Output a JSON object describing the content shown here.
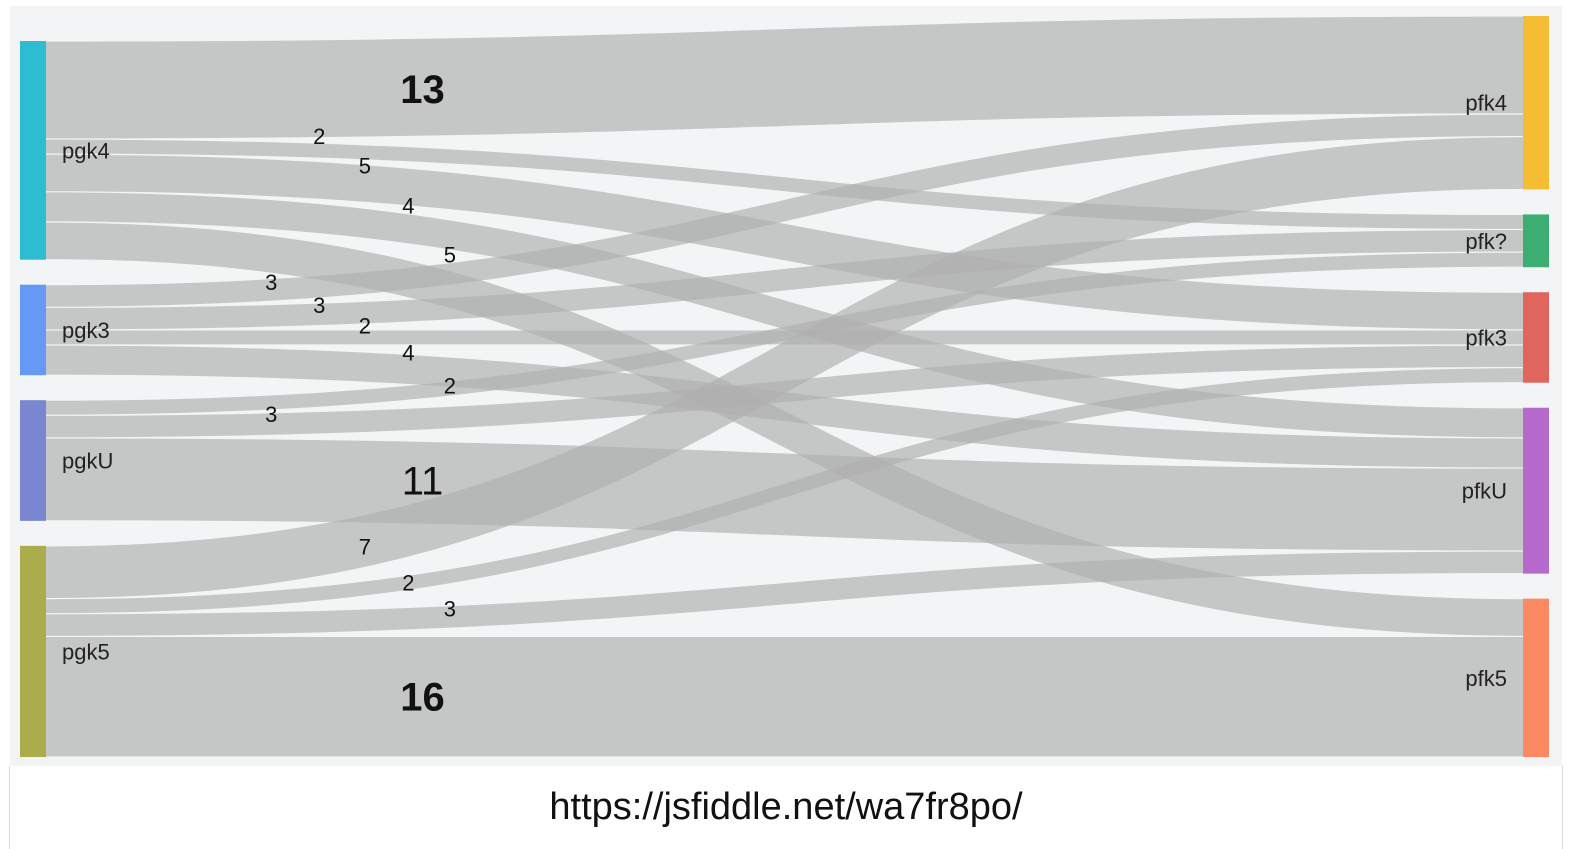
{
  "footer": {
    "url": "https://jsfiddle.net/wa7fr8po/"
  },
  "colors": {
    "background": "#f3f4f5",
    "link": "#b0b0b0",
    "pgk4": "#2ebcd3",
    "pgk3": "#6699f5",
    "pgkU": "#7a86cf",
    "pgk5": "#abad4c",
    "pfk4": "#f4bd34",
    "pfk?": "#3cae72",
    "pfk3": "#e0655c",
    "pfkU": "#b56acb",
    "pfk5": "#fb8a62"
  },
  "chart_data": {
    "type": "sankey",
    "nodes": [
      {
        "id": "pgk4",
        "label": "pgk4",
        "side": "left"
      },
      {
        "id": "pgk3",
        "label": "pgk3",
        "side": "left"
      },
      {
        "id": "pgkU",
        "label": "pgkU",
        "side": "left"
      },
      {
        "id": "pgk5",
        "label": "pgk5",
        "side": "left"
      },
      {
        "id": "pfk4",
        "label": "pfk4",
        "side": "right"
      },
      {
        "id": "pfk?",
        "label": "pfk?",
        "side": "right"
      },
      {
        "id": "pfk3",
        "label": "pfk3",
        "side": "right"
      },
      {
        "id": "pfkU",
        "label": "pfkU",
        "side": "right"
      },
      {
        "id": "pfk5",
        "label": "pfk5",
        "side": "right"
      }
    ],
    "links": [
      {
        "source": "pgk4",
        "target": "pfk4",
        "value": 13,
        "label": "13"
      },
      {
        "source": "pgk4",
        "target": "pfk?",
        "value": 2,
        "label": "2"
      },
      {
        "source": "pgk4",
        "target": "pfk3",
        "value": 5,
        "label": "5"
      },
      {
        "source": "pgk4",
        "target": "pfkU",
        "value": 4,
        "label": "4"
      },
      {
        "source": "pgk4",
        "target": "pfk5",
        "value": 5,
        "label": "5"
      },
      {
        "source": "pgk3",
        "target": "pfk4",
        "value": 3,
        "label": "3"
      },
      {
        "source": "pgk3",
        "target": "pfk?",
        "value": 3,
        "label": "3"
      },
      {
        "source": "pgk3",
        "target": "pfk3",
        "value": 2,
        "label": "2"
      },
      {
        "source": "pgk3",
        "target": "pfkU",
        "value": 4,
        "label": "4"
      },
      {
        "source": "pgkU",
        "target": "pfk?",
        "value": 2,
        "label": "2"
      },
      {
        "source": "pgkU",
        "target": "pfk3",
        "value": 3,
        "label": "3"
      },
      {
        "source": "pgkU",
        "target": "pfkU",
        "value": 11,
        "label": "11"
      },
      {
        "source": "pgk5",
        "target": "pfk4",
        "value": 7,
        "label": "7"
      },
      {
        "source": "pgk5",
        "target": "pfk3",
        "value": 2,
        "label": "2"
      },
      {
        "source": "pgk5",
        "target": "pfkU",
        "value": 3,
        "label": "3"
      },
      {
        "source": "pgk5",
        "target": "pfk5",
        "value": 16,
        "label": "16"
      }
    ]
  }
}
